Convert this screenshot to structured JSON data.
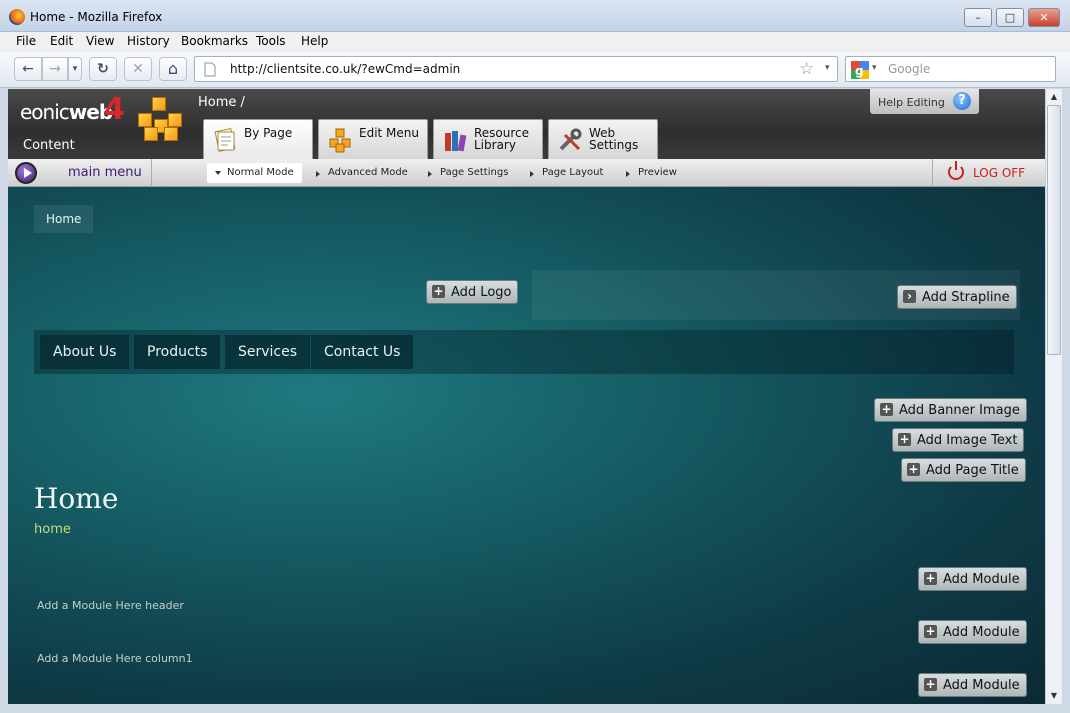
{
  "window": {
    "title": "Home - Mozilla Firefox",
    "controls": [
      "–",
      "□",
      "✕"
    ]
  },
  "menubar": {
    "items": [
      "File",
      "Edit",
      "View",
      "History",
      "Bookmarks",
      "Tools",
      "Help"
    ]
  },
  "toolbar": {
    "back": "←",
    "forward": "→",
    "dropdown": "▾",
    "reload": "↻",
    "stop": "✕",
    "home": "⌂",
    "url": "http://clientsite.co.uk/?ewCmd=admin",
    "bookmark_star": "☆",
    "search_placeholder": "Google"
  },
  "admin": {
    "logo_text_light": "eonic",
    "logo_text_bold": "web",
    "logo_number": "4",
    "logo_sub": "Content",
    "breadcrumb": "Home /",
    "help_label": "Help Editing",
    "help_icon": "?",
    "tabs": [
      {
        "line1": "By Page",
        "line2": ""
      },
      {
        "line1": "Edit Menu",
        "line2": ""
      },
      {
        "line1": "Resource",
        "line2": "Library"
      },
      {
        "line1": "Web",
        "line2": "Settings"
      }
    ],
    "main_menu": "main menu",
    "modes": [
      "Normal Mode",
      "Advanced Mode",
      "Page Settings",
      "Page Layout",
      "Preview"
    ],
    "logoff": "LOG OFF"
  },
  "site": {
    "breadcrumb": "Home",
    "add_logo": "Add Logo",
    "add_strapline": "Add Strapline",
    "nav": [
      "About Us",
      "Products",
      "Services",
      "Contact Us"
    ],
    "add_banner_image": "Add Banner Image",
    "add_image_text": "Add Image Text",
    "add_page_title": "Add Page Title",
    "page_title": "Home",
    "page_subtitle": "home",
    "add_module": "Add Module",
    "module_header": "Add a Module Here header",
    "module_column1": "Add a Module Here column1"
  },
  "colors": {
    "site_bg": "#155b63",
    "accent_red": "#c8201b",
    "subtitle": "#c8dc7a",
    "main_menu": "#3b1a6e"
  }
}
